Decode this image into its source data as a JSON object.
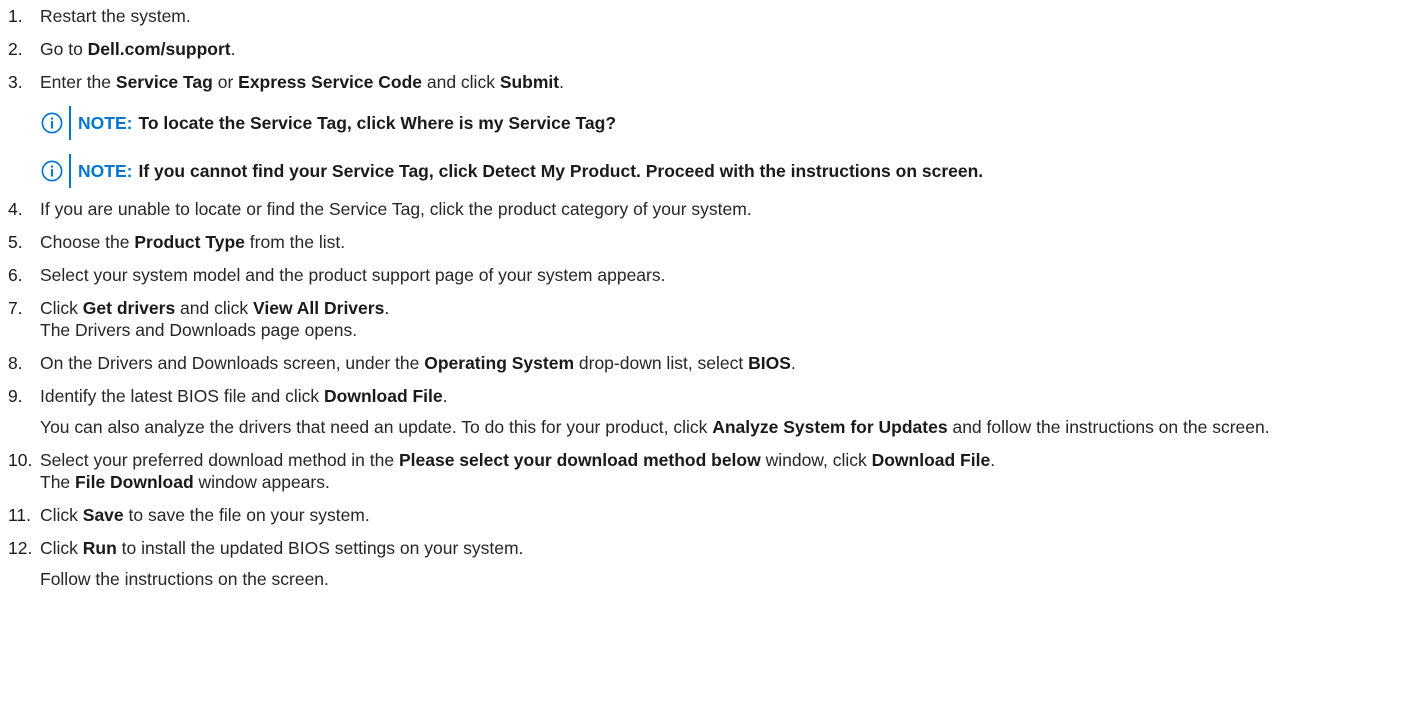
{
  "steps": [
    {
      "num": "1.",
      "a": "Restart the system."
    },
    {
      "num": "2.",
      "a": "Go to ",
      "b1": "Dell.com/support",
      "c": "."
    },
    {
      "num": "3.",
      "a": "Enter the ",
      "b1": "Service Tag",
      "c": " or ",
      "b2": "Express Service Code",
      "d": " and click ",
      "b3": "Submit",
      "e": "."
    },
    {
      "num": "4.",
      "a": "If you are unable to locate or find the Service Tag, click the product category of your system."
    },
    {
      "num": "5.",
      "a": "Choose the ",
      "b1": "Product Type",
      "c": " from the list."
    },
    {
      "num": "6.",
      "a": "Select your system model and the product support page of your system appears."
    },
    {
      "num": "7.",
      "a": "Click ",
      "b1": "Get drivers",
      "c": " and click ",
      "b2": "View All Drivers",
      "d": ".",
      "sub": "The Drivers and Downloads page opens."
    },
    {
      "num": "8.",
      "a": "On the Drivers and Downloads screen, under the ",
      "b1": "Operating System",
      "c": " drop-down list, select ",
      "b2": "BIOS",
      "d": "."
    },
    {
      "num": "9.",
      "a": "Identify the latest BIOS file and click ",
      "b1": "Download File",
      "c": ".",
      "p1": "You can also analyze the drivers that need an update. To do this for your product, click ",
      "pb": "Analyze System for Updates",
      "p2": " and follow the instructions on the screen."
    },
    {
      "num": "10.",
      "a": "Select your preferred download method in the ",
      "b1": "Please select your download method below",
      "c": " window, click ",
      "b2": "Download File",
      "d": ".",
      "s1": "The ",
      "sb": "File Download",
      "s2": " window appears."
    },
    {
      "num": "11.",
      "a": "Click ",
      "b1": "Save",
      "c": " to save the file on your system."
    },
    {
      "num": "12.",
      "a": "Click ",
      "b1": "Run",
      "c": " to install the updated BIOS settings on your system.",
      "p1": "Follow the instructions on the screen."
    }
  ],
  "notes": [
    {
      "label": "NOTE:",
      "text": "To locate the Service Tag, click Where is my Service Tag?"
    },
    {
      "label": "NOTE:",
      "text": "If you cannot find your Service Tag, click Detect My Product. Proceed with the instructions on screen."
    }
  ],
  "icons": {
    "note": "info-circle-icon"
  },
  "colors": {
    "note_accent": "#0076ce",
    "text": "#262626"
  }
}
